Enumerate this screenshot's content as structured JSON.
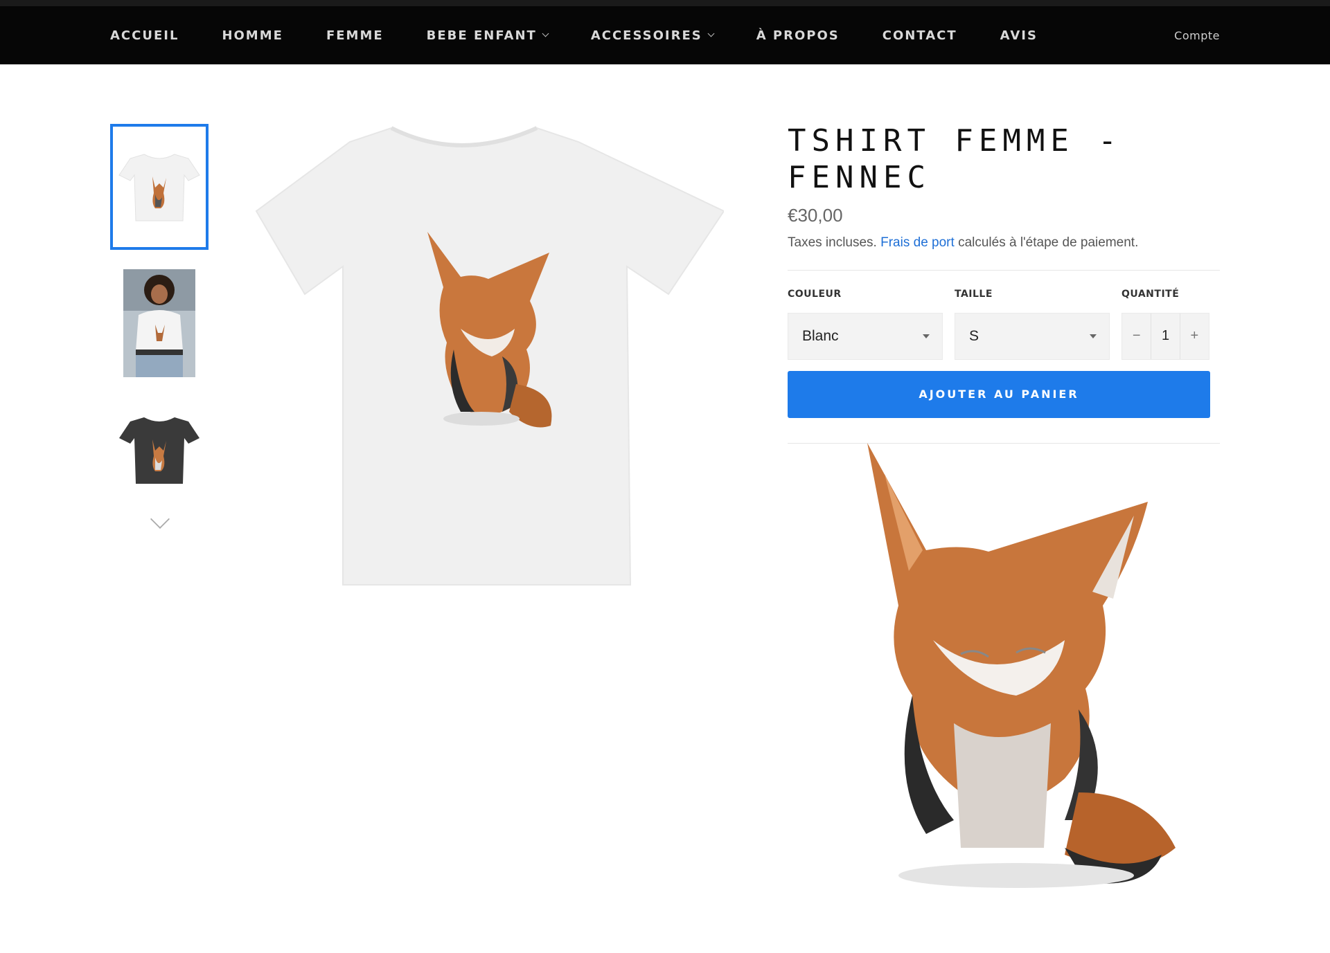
{
  "nav": {
    "items": [
      {
        "label": "ACCUEIL",
        "has_dropdown": false
      },
      {
        "label": "HOMME",
        "has_dropdown": false
      },
      {
        "label": "FEMME",
        "has_dropdown": false
      },
      {
        "label": "BEBE ENFANT",
        "has_dropdown": true
      },
      {
        "label": "ACCESSOIRES",
        "has_dropdown": true
      },
      {
        "label": "À PROPOS",
        "has_dropdown": false
      },
      {
        "label": "CONTACT",
        "has_dropdown": false
      },
      {
        "label": "AVIS",
        "has_dropdown": false
      }
    ],
    "account": "Compte"
  },
  "gallery": {
    "thumbnails": [
      {
        "icon": "white-tshirt-fox-thumbnail",
        "selected": true
      },
      {
        "icon": "model-wearing-tshirt-thumbnail",
        "selected": false
      },
      {
        "icon": "black-tshirt-fox-thumbnail",
        "selected": false
      }
    ],
    "more_icon": "chevron-down-icon"
  },
  "product": {
    "title": "TSHIRT FEMME - FENNEC",
    "price": "€30,00",
    "tax_prefix": "Taxes incluses.",
    "tax_link": "Frais de port",
    "tax_suffix": "calculés à l'étape de paiement.",
    "color_label": "COULEUR",
    "color_value": "Blanc",
    "size_label": "TAILLE",
    "size_value": "S",
    "quantity_label": "QUANTITÉ",
    "quantity_value": "1",
    "minus": "−",
    "plus": "+",
    "add_to_cart": "AJOUTER AU PANIER"
  },
  "colors": {
    "accent": "#1e7bea",
    "nav_bg": "#060606",
    "link": "#1e6fd6"
  }
}
